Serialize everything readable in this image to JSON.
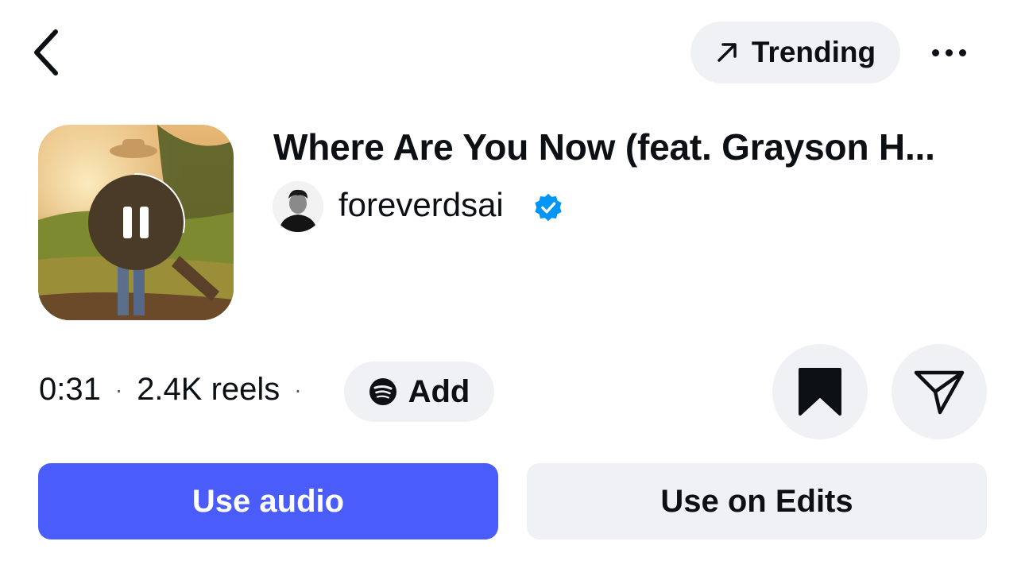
{
  "header": {
    "back_icon": "chevron-left-icon",
    "trending_label": "Trending",
    "trending_icon": "arrow-up-right-icon",
    "more_icon": "ellipsis-icon"
  },
  "track": {
    "title": "Where Are You Now (feat. Grayson H...",
    "artist": "foreverdsai",
    "verified": true,
    "play_state": "playing",
    "playback_progress": 0.28
  },
  "meta": {
    "duration": "0:31",
    "separator": "·",
    "reels": "2.4K reels",
    "add_label": "Add",
    "add_icon": "spotify-icon"
  },
  "actions": {
    "save_icon": "bookmark-icon",
    "share_icon": "send-icon",
    "use_audio_label": "Use audio",
    "use_edits_label": "Use on Edits"
  },
  "colors": {
    "accent": "#4a5dfb",
    "chip_bg": "#eff1f4",
    "verified": "#0095f6",
    "text": "#0c1014"
  }
}
